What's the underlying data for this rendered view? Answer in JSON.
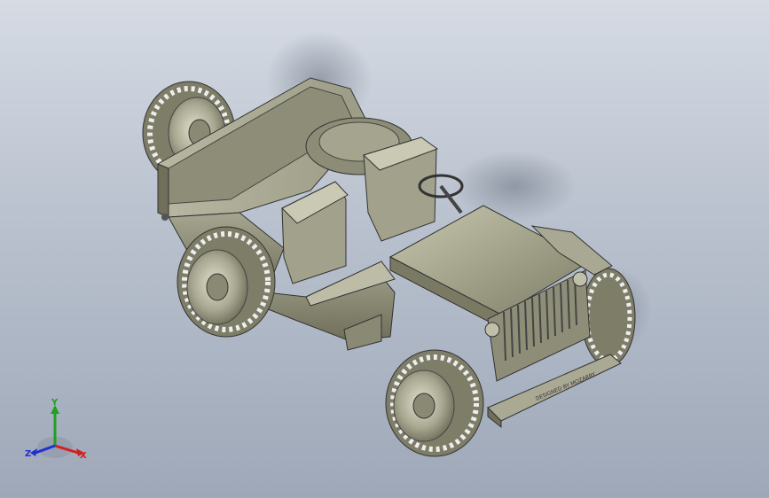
{
  "viewport": {
    "background_top": "#d6dbe4",
    "background_bottom": "#9ea8b8",
    "model": {
      "body_color": "#9a9a82",
      "body_light": "#c9c9b3",
      "body_dark": "#6f6f5a",
      "tire_color": "#8d8d77",
      "front_bumper_text": "DESIGNED BY MOZARRY"
    }
  },
  "triad": {
    "x_label": "X",
    "y_label": "Y",
    "z_label": "Z",
    "x_color": "#d22020",
    "y_color": "#20a020",
    "z_color": "#2030d0"
  }
}
